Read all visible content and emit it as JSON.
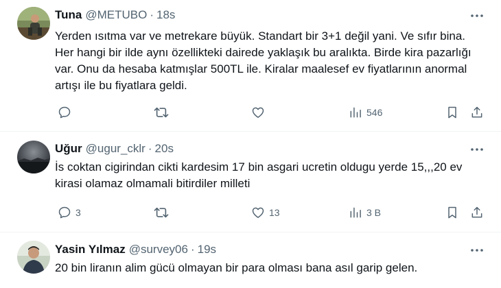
{
  "tweets": [
    {
      "name": "Tuna",
      "handle": "@METUBO",
      "time": "18s",
      "text": "Yerden ısıtma var ve metrekare büyük. Standart bir 3+1 değil yani. Ve sıfır bina. Her hangi bir ilde aynı özellikteki dairede yaklaşık bu aralıkta. Birde kira pazarlığı var. Onu da hesaba katmışlar 500TL ile. Kiralar maalesef ev fiyatlarının anormal artışı ile bu fiyatlara geldi.",
      "replies": "",
      "retweets": "",
      "likes": "",
      "views": "546"
    },
    {
      "name": "Uğur",
      "handle": "@ugur_cklr",
      "time": "20s",
      "text": "İs coktan cigirindan cikti kardesim 17 bin asgari ucretin oldugu yerde 15,,,20 ev kirasi olamaz olmamali bitirdiler milleti",
      "replies": "3",
      "retweets": "",
      "likes": "13",
      "views": "3 B"
    },
    {
      "name": "Yasin Yılmaz",
      "handle": "@survey06",
      "time": "19s",
      "text": "20 bin liranın alim gücü olmayan bir para olması bana asıl garip gelen."
    }
  ],
  "icons": {
    "more": "more-dots-icon",
    "reply": "reply-icon",
    "retweet": "retweet-icon",
    "like": "heart-icon",
    "views": "views-bar-chart-icon",
    "bookmark": "bookmark-icon",
    "share": "share-icon"
  },
  "colors": {
    "text": "#0f1419",
    "secondary": "#536471",
    "divider": "#eff3f4"
  }
}
